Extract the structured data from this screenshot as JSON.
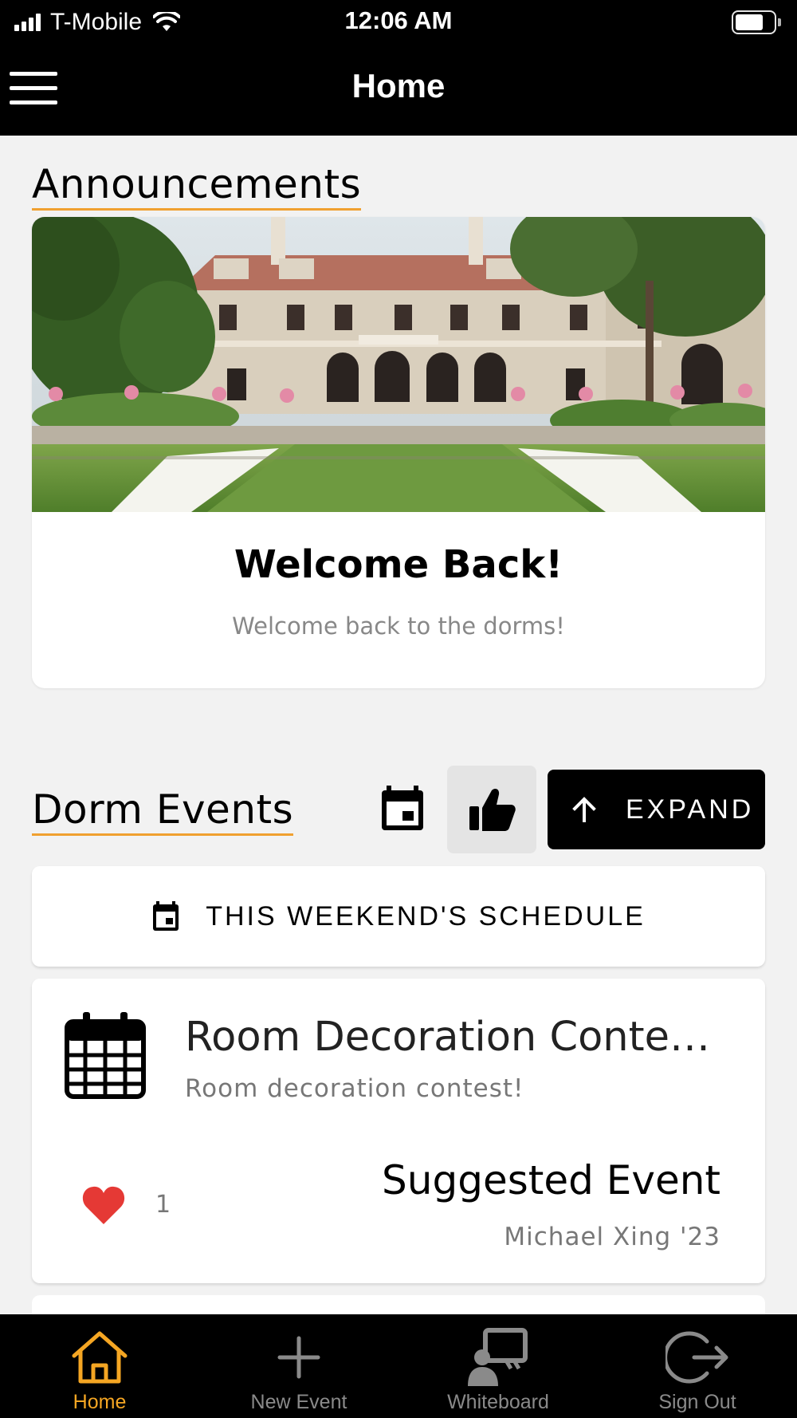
{
  "status_bar": {
    "carrier": "T-Mobile",
    "time": "12:06 AM"
  },
  "nav": {
    "title": "Home"
  },
  "announcements": {
    "heading": "Announcements",
    "card": {
      "title": "Welcome Back!",
      "subtitle": "Welcome back to the dorms!"
    }
  },
  "dorm_events": {
    "heading": "Dorm Events",
    "expand_label": "EXPAND",
    "schedule_label": "THIS WEEKEND'S SCHEDULE",
    "events": [
      {
        "title": "Room Decoration Conte…",
        "description": "Room decoration contest!",
        "likes": "1",
        "type_label": "Suggested Event",
        "author": "Michael Xing '23"
      }
    ]
  },
  "tab_bar": {
    "tabs": [
      {
        "label": "Home",
        "icon": "home-icon",
        "active": true
      },
      {
        "label": "New Event",
        "icon": "plus-icon",
        "active": false
      },
      {
        "label": "Whiteboard",
        "icon": "whiteboard-icon",
        "active": false
      },
      {
        "label": "Sign Out",
        "icon": "sign-out-icon",
        "active": false
      }
    ]
  },
  "colors": {
    "accent": "#f5a623",
    "heart": "#e53935",
    "bar": "#000000",
    "background": "#f2f2f2"
  }
}
